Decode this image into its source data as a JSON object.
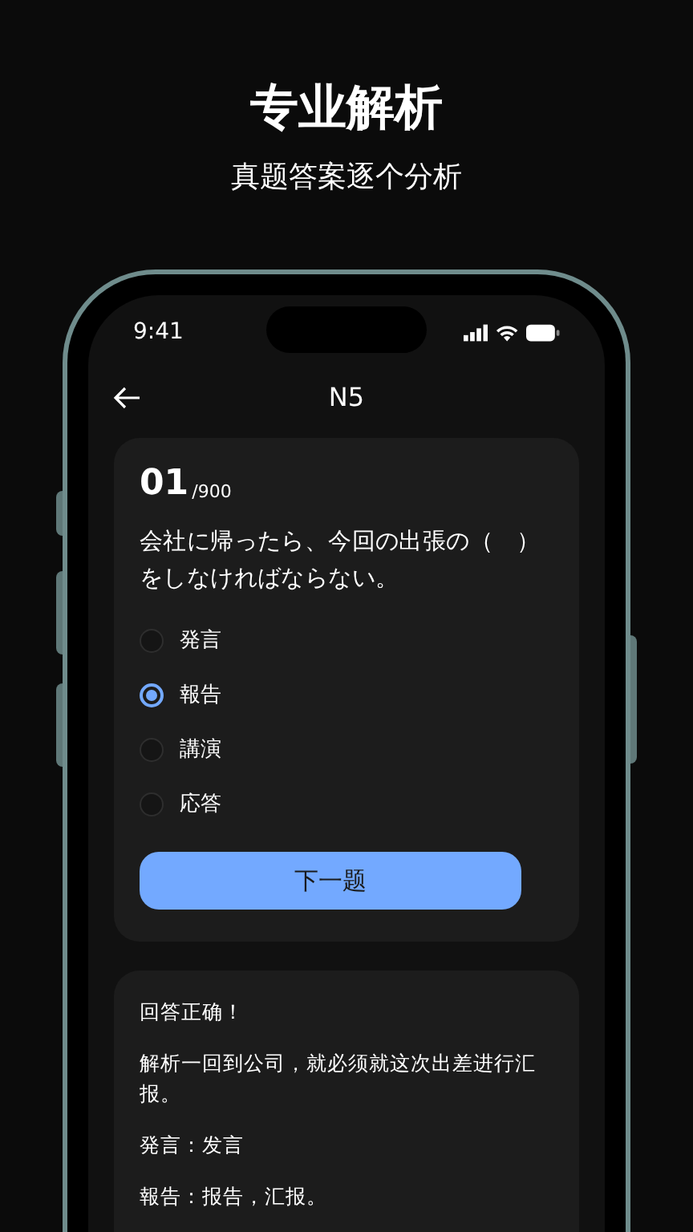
{
  "headline": {
    "title": "专业解析",
    "subtitle": "真题答案逐个分析"
  },
  "status_bar": {
    "time": "9:41"
  },
  "nav": {
    "title": "N5"
  },
  "question": {
    "number": "01",
    "total": "/900",
    "text": "会社に帰ったら、今回の出張の（　）をしなければならない。",
    "options": [
      {
        "label": "発言",
        "selected": false
      },
      {
        "label": "報告",
        "selected": true
      },
      {
        "label": "講演",
        "selected": false
      },
      {
        "label": "応答",
        "selected": false
      }
    ],
    "next_button": "下一题"
  },
  "explanation": [
    "回答正确！",
    "解析一回到公司，就必须就这次出差进行汇报。",
    "発言：发言",
    "報告：报告，汇报。"
  ]
}
